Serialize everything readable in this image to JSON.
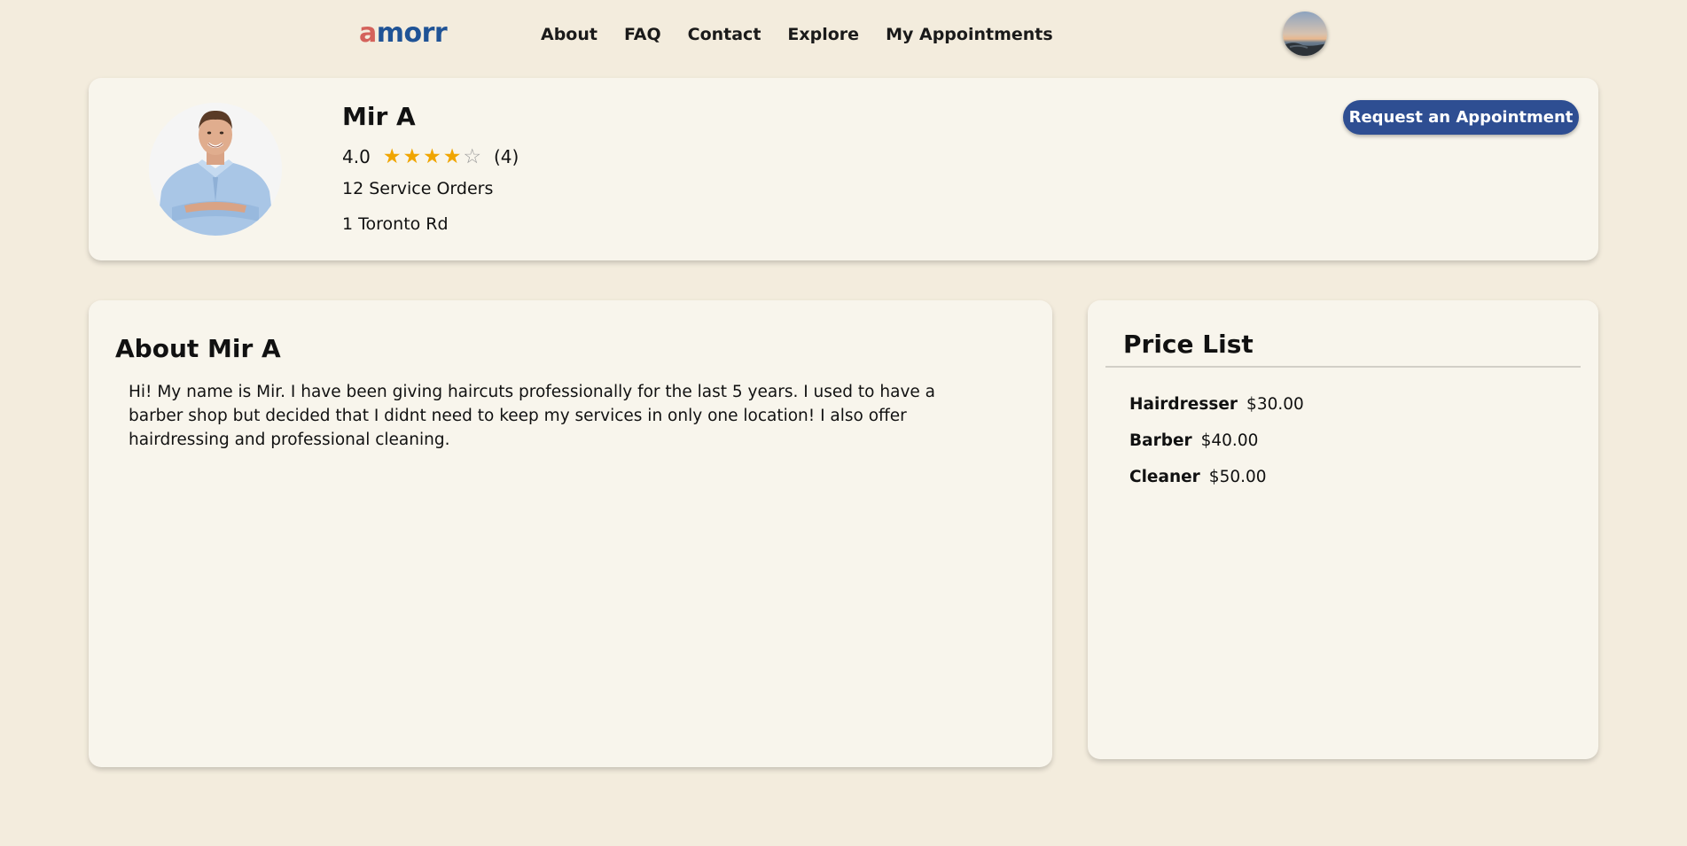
{
  "nav": {
    "logo_first": "a",
    "logo_rest": "morr",
    "links": [
      "About",
      "FAQ",
      "Contact",
      "Explore",
      "My Appointments"
    ],
    "avatar_icon": "user-avatar-landscape"
  },
  "profile": {
    "name": "Mir A",
    "rating": "4.0",
    "stars_filled": 4,
    "stars_total": 5,
    "review_count": "(4)",
    "service_orders": "12 Service Orders",
    "address": "1 Toronto Rd",
    "request_button": "Request an Appointment"
  },
  "about": {
    "title": "About Mir A",
    "text": "Hi! My name is Mir. I have been giving haircuts professionally for the last 5 years. I used to have a barber shop but decided that I didnt need to keep my services in only one location! I also offer hairdressing and professional cleaning."
  },
  "prices": {
    "title": "Price List",
    "items": [
      {
        "name": "Hairdresser",
        "price": "$30.00"
      },
      {
        "name": "Barber",
        "price": "$40.00"
      },
      {
        "name": "Cleaner",
        "price": "$50.00"
      }
    ]
  },
  "colors": {
    "background": "#f3ecdd",
    "card": "#f8f5ec",
    "brand_red": "#d4625b",
    "brand_blue": "#1f5396",
    "button": "#2e4e92",
    "star": "#f0a500"
  }
}
